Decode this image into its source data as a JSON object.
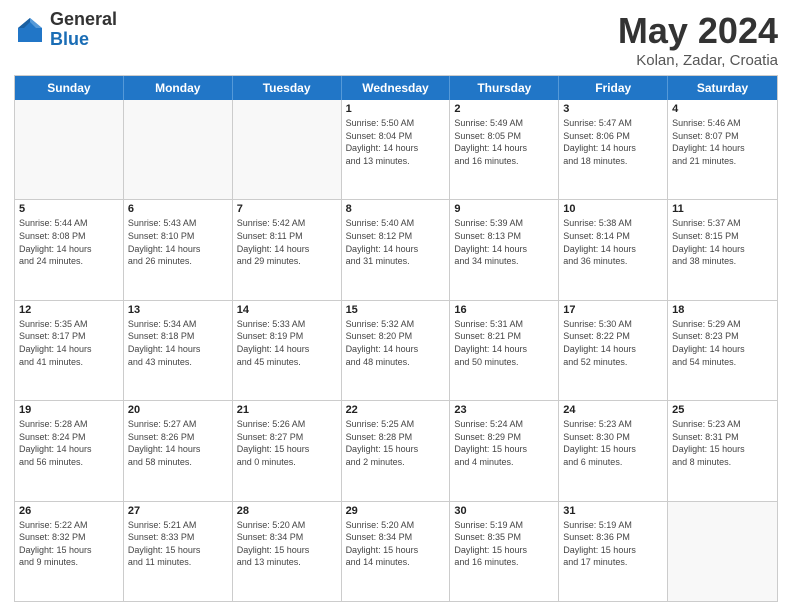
{
  "header": {
    "logo_general": "General",
    "logo_blue": "Blue",
    "title": "May 2024",
    "location": "Kolan, Zadar, Croatia"
  },
  "days_of_week": [
    "Sunday",
    "Monday",
    "Tuesday",
    "Wednesday",
    "Thursday",
    "Friday",
    "Saturday"
  ],
  "weeks": [
    [
      {
        "day": "",
        "info": ""
      },
      {
        "day": "",
        "info": ""
      },
      {
        "day": "",
        "info": ""
      },
      {
        "day": "1",
        "info": "Sunrise: 5:50 AM\nSunset: 8:04 PM\nDaylight: 14 hours\nand 13 minutes."
      },
      {
        "day": "2",
        "info": "Sunrise: 5:49 AM\nSunset: 8:05 PM\nDaylight: 14 hours\nand 16 minutes."
      },
      {
        "day": "3",
        "info": "Sunrise: 5:47 AM\nSunset: 8:06 PM\nDaylight: 14 hours\nand 18 minutes."
      },
      {
        "day": "4",
        "info": "Sunrise: 5:46 AM\nSunset: 8:07 PM\nDaylight: 14 hours\nand 21 minutes."
      }
    ],
    [
      {
        "day": "5",
        "info": "Sunrise: 5:44 AM\nSunset: 8:08 PM\nDaylight: 14 hours\nand 24 minutes."
      },
      {
        "day": "6",
        "info": "Sunrise: 5:43 AM\nSunset: 8:10 PM\nDaylight: 14 hours\nand 26 minutes."
      },
      {
        "day": "7",
        "info": "Sunrise: 5:42 AM\nSunset: 8:11 PM\nDaylight: 14 hours\nand 29 minutes."
      },
      {
        "day": "8",
        "info": "Sunrise: 5:40 AM\nSunset: 8:12 PM\nDaylight: 14 hours\nand 31 minutes."
      },
      {
        "day": "9",
        "info": "Sunrise: 5:39 AM\nSunset: 8:13 PM\nDaylight: 14 hours\nand 34 minutes."
      },
      {
        "day": "10",
        "info": "Sunrise: 5:38 AM\nSunset: 8:14 PM\nDaylight: 14 hours\nand 36 minutes."
      },
      {
        "day": "11",
        "info": "Sunrise: 5:37 AM\nSunset: 8:15 PM\nDaylight: 14 hours\nand 38 minutes."
      }
    ],
    [
      {
        "day": "12",
        "info": "Sunrise: 5:35 AM\nSunset: 8:17 PM\nDaylight: 14 hours\nand 41 minutes."
      },
      {
        "day": "13",
        "info": "Sunrise: 5:34 AM\nSunset: 8:18 PM\nDaylight: 14 hours\nand 43 minutes."
      },
      {
        "day": "14",
        "info": "Sunrise: 5:33 AM\nSunset: 8:19 PM\nDaylight: 14 hours\nand 45 minutes."
      },
      {
        "day": "15",
        "info": "Sunrise: 5:32 AM\nSunset: 8:20 PM\nDaylight: 14 hours\nand 48 minutes."
      },
      {
        "day": "16",
        "info": "Sunrise: 5:31 AM\nSunset: 8:21 PM\nDaylight: 14 hours\nand 50 minutes."
      },
      {
        "day": "17",
        "info": "Sunrise: 5:30 AM\nSunset: 8:22 PM\nDaylight: 14 hours\nand 52 minutes."
      },
      {
        "day": "18",
        "info": "Sunrise: 5:29 AM\nSunset: 8:23 PM\nDaylight: 14 hours\nand 54 minutes."
      }
    ],
    [
      {
        "day": "19",
        "info": "Sunrise: 5:28 AM\nSunset: 8:24 PM\nDaylight: 14 hours\nand 56 minutes."
      },
      {
        "day": "20",
        "info": "Sunrise: 5:27 AM\nSunset: 8:26 PM\nDaylight: 14 hours\nand 58 minutes."
      },
      {
        "day": "21",
        "info": "Sunrise: 5:26 AM\nSunset: 8:27 PM\nDaylight: 15 hours\nand 0 minutes."
      },
      {
        "day": "22",
        "info": "Sunrise: 5:25 AM\nSunset: 8:28 PM\nDaylight: 15 hours\nand 2 minutes."
      },
      {
        "day": "23",
        "info": "Sunrise: 5:24 AM\nSunset: 8:29 PM\nDaylight: 15 hours\nand 4 minutes."
      },
      {
        "day": "24",
        "info": "Sunrise: 5:23 AM\nSunset: 8:30 PM\nDaylight: 15 hours\nand 6 minutes."
      },
      {
        "day": "25",
        "info": "Sunrise: 5:23 AM\nSunset: 8:31 PM\nDaylight: 15 hours\nand 8 minutes."
      }
    ],
    [
      {
        "day": "26",
        "info": "Sunrise: 5:22 AM\nSunset: 8:32 PM\nDaylight: 15 hours\nand 9 minutes."
      },
      {
        "day": "27",
        "info": "Sunrise: 5:21 AM\nSunset: 8:33 PM\nDaylight: 15 hours\nand 11 minutes."
      },
      {
        "day": "28",
        "info": "Sunrise: 5:20 AM\nSunset: 8:34 PM\nDaylight: 15 hours\nand 13 minutes."
      },
      {
        "day": "29",
        "info": "Sunrise: 5:20 AM\nSunset: 8:34 PM\nDaylight: 15 hours\nand 14 minutes."
      },
      {
        "day": "30",
        "info": "Sunrise: 5:19 AM\nSunset: 8:35 PM\nDaylight: 15 hours\nand 16 minutes."
      },
      {
        "day": "31",
        "info": "Sunrise: 5:19 AM\nSunset: 8:36 PM\nDaylight: 15 hours\nand 17 minutes."
      },
      {
        "day": "",
        "info": ""
      }
    ]
  ]
}
